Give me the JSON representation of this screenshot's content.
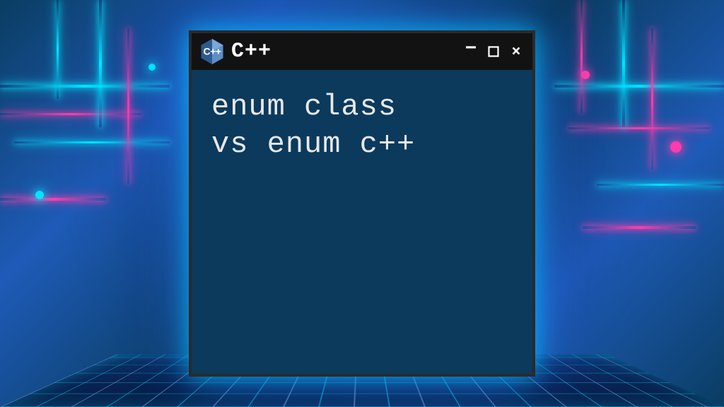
{
  "window": {
    "icon_label": "C++",
    "title": "C++",
    "controls": {
      "minimize": "−",
      "close": "×"
    }
  },
  "content": {
    "line1": "enum class",
    "line2": "vs enum c++"
  },
  "colors": {
    "window_bg": "#0b3a5c",
    "titlebar_bg": "#121212",
    "neon_cyan": "#00e5ff",
    "neon_pink": "#ff3dac",
    "icon_blue": "#5c8ec8",
    "icon_dark": "#2e5a8f"
  }
}
